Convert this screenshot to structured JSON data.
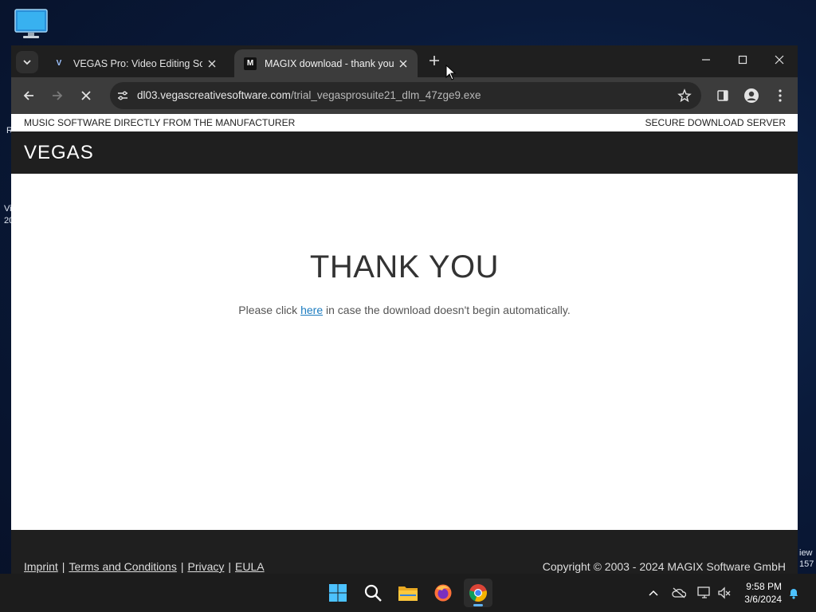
{
  "desktop": {
    "left_fragments": [
      "R",
      "Vi",
      "20"
    ],
    "right_fragments": [
      "iew",
      "157"
    ]
  },
  "browser": {
    "tabs": [
      {
        "title": "VEGAS Pro: Video Editing Softw",
        "favicon": "V",
        "active": false
      },
      {
        "title": "MAGIX download - thank you",
        "favicon": "M",
        "active": true
      }
    ],
    "url_host": "dl03.vegascreativesoftware.com",
    "url_path": "/trial_vegasprosuite21_dlm_47zge9.exe"
  },
  "page": {
    "top_left": "MUSIC SOFTWARE DIRECTLY FROM THE MANUFACTURER",
    "top_right": "SECURE DOWNLOAD SERVER",
    "logo": "VEGAS",
    "heading": "THANK YOU",
    "msg_before": "Please click ",
    "msg_link": "here",
    "msg_after": " in case the download doesn't begin automatically.",
    "footer_links": [
      "Imprint",
      "Terms and Conditions",
      "Privacy",
      "EULA"
    ],
    "copyright": "Copyright © 2003 - 2024 MAGIX Software GmbH"
  },
  "taskbar": {
    "time": "9:58 PM",
    "date": "3/6/2024"
  },
  "colors": {
    "link": "#1c7cc0",
    "dark_bar": "#1f1f1f",
    "chrome_toolbar": "#3c3c3c"
  }
}
